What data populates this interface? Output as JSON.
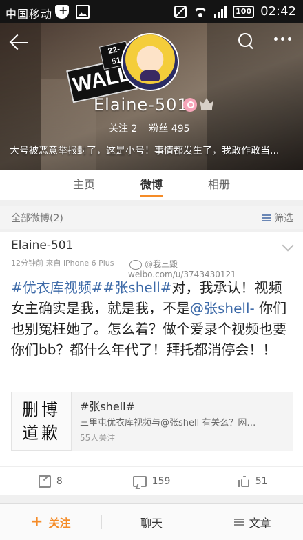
{
  "status_bar": {
    "carrier": "中国移动",
    "time": "02:42",
    "battery": "100"
  },
  "profile": {
    "sign_number": "22-51",
    "sign_text": "WALL",
    "username": "Elaine-501",
    "following_label": "关注",
    "following_count": "2",
    "followers_label": "粉丝",
    "followers_count": "495",
    "bio": "大号被恶意举报封了，这是小号！事情都发生了，我敢作敢当..."
  },
  "tabs": [
    {
      "label": "主页",
      "active": false
    },
    {
      "label": "微博",
      "active": true
    },
    {
      "label": "相册",
      "active": false
    }
  ],
  "section": {
    "label": "全部微博(2)",
    "filter_label": "筛选"
  },
  "post": {
    "author": "Elaine-501",
    "time": "12分钟前",
    "source": "来自 iPhone 6 Plus",
    "watermark_line1": "@我三毁",
    "watermark_line2": "weibo.com/u/3743430121",
    "text_topic": "#优衣库视频##张shell#",
    "text_part1": "对，我承认！视频女主确实是我，就是我，不是",
    "text_mention": "@张shell-",
    "text_part2": " 你们也别冤枉她了。怎么着？做个爱录个视频也要你们bb？都什么年代了！拜托都消停会！！",
    "topic_card": {
      "thumb_line1": "删博",
      "thumb_line2": "道歉",
      "title": "#张shell#",
      "desc": "三里屯优衣库视频与@张shell 有关么？网…",
      "followers": "55人关注"
    },
    "actions": {
      "reposts": "8",
      "comments": "159",
      "likes": "51"
    }
  },
  "bottom_bar": {
    "follow_label": "关注",
    "chat_label": "聊天",
    "article_label": "文章"
  },
  "colors": {
    "accent": "#f58c28",
    "link": "#3d6aa8"
  }
}
